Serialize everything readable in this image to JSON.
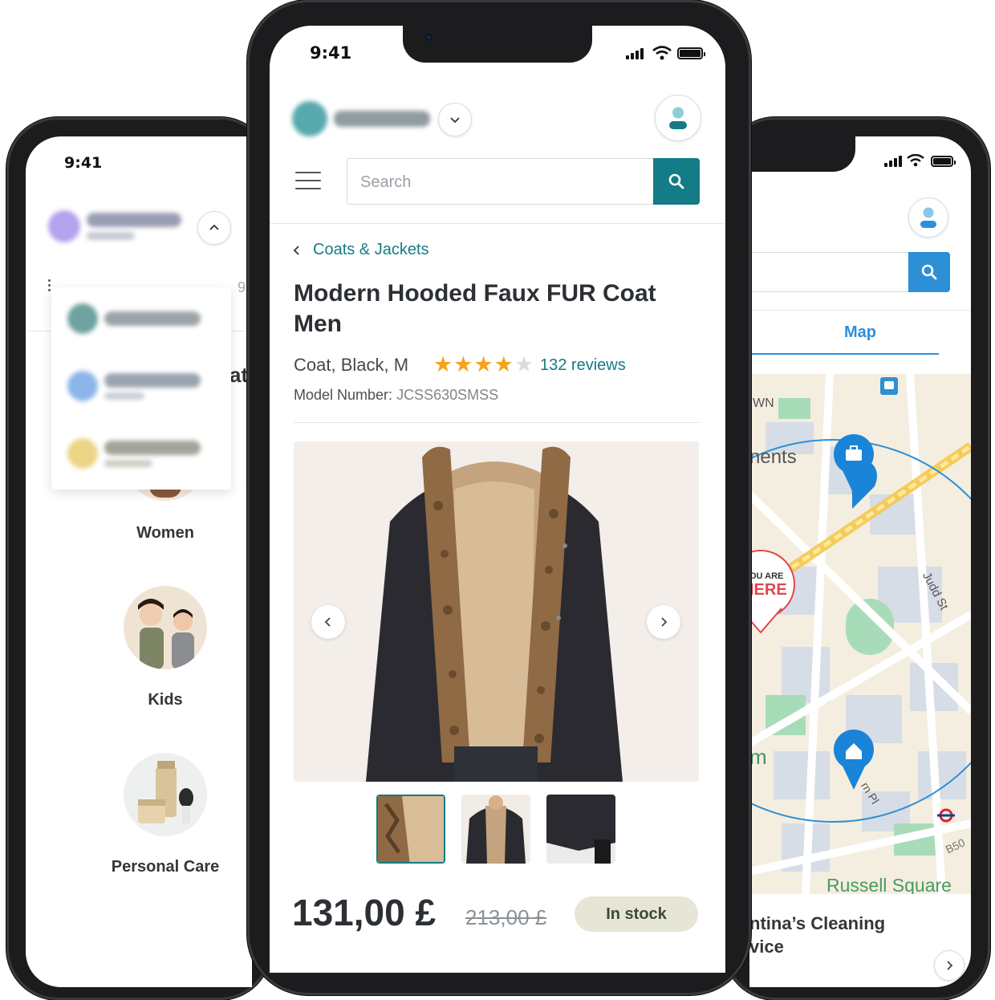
{
  "left_phone": {
    "status_time": "9:41",
    "categories": [
      {
        "label": "Women"
      },
      {
        "label": "Kids"
      },
      {
        "label": "Personal Care"
      }
    ],
    "partial_text_at": "at",
    "partial_text_9": "9"
  },
  "center_phone": {
    "status_time": "9:41",
    "search": {
      "placeholder": "Search"
    },
    "breadcrumb": "Coats & Jackets",
    "product": {
      "title": "Modern Hooded Faux FUR Coat Men",
      "variant": "Coat, Black, M",
      "rating": 4,
      "rating_max": 5,
      "reviews": "132 reviews",
      "model_label": "Model Number: ",
      "model_value": "JCSS630SMSS",
      "price": "131,00 £",
      "old_price": "213,00 £",
      "stock": "In stock"
    },
    "thumbnail_count": 3,
    "active_thumbnail": 1
  },
  "right_phone": {
    "tab": "Map",
    "map_labels": {
      "wn": "WN",
      "ments": "nents",
      "you_are": "OU ARE",
      "here": "IERE",
      "m": "m",
      "judd": "Judd St",
      "pl": "rn Pl",
      "b50": "B50",
      "russell": "Russell Square"
    },
    "service": "ntina’s Cleaning\nvice"
  },
  "colors": {
    "accent": "#147c86",
    "map_blue": "#2d8fd6",
    "star": "#f3a31c",
    "stock_bg": "#e6e5d6"
  }
}
